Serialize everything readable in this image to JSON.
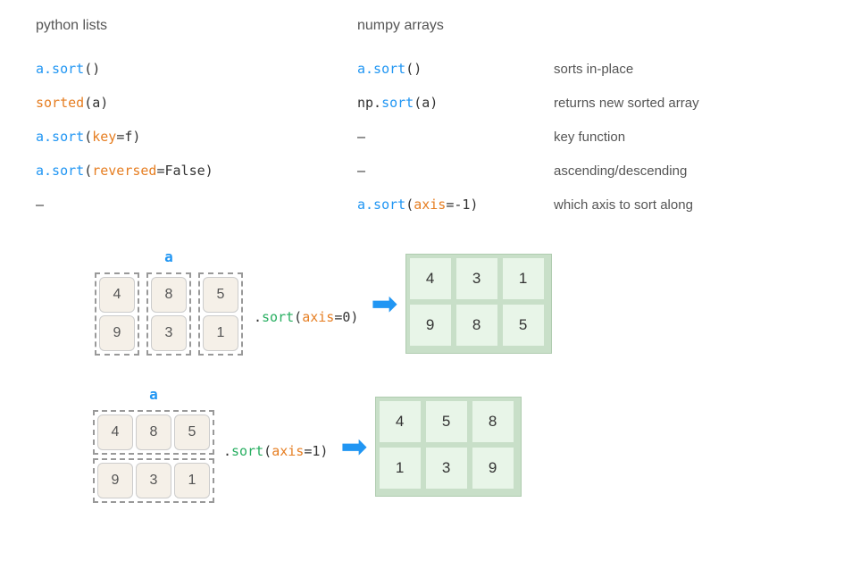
{
  "headers": {
    "python_lists": "python lists",
    "numpy_arrays": "numpy arrays"
  },
  "table": {
    "rows": [
      {
        "python": {
          "text": "a.sort()",
          "parts": [
            {
              "t": "blue",
              "v": "a.sort"
            },
            {
              "t": "dark",
              "v": "()"
            }
          ]
        },
        "numpy": {
          "text": "a.sort()",
          "parts": [
            {
              "t": "blue",
              "v": "a.sort"
            },
            {
              "t": "dark",
              "v": "()"
            }
          ]
        },
        "desc": "sorts in-place"
      },
      {
        "python": {
          "text": "sorted(a)",
          "parts": [
            {
              "t": "orange",
              "v": "sorted"
            },
            {
              "t": "dark",
              "v": "(a)"
            }
          ]
        },
        "numpy": {
          "text": "np.sort(a)",
          "parts": [
            {
              "t": "dark",
              "v": "np."
            },
            {
              "t": "blue",
              "v": "sort"
            },
            {
              "t": "dark",
              "v": "(a)"
            }
          ]
        },
        "desc": "returns new sorted array"
      },
      {
        "python": {
          "text": "a.sort(key=f)",
          "parts": [
            {
              "t": "blue",
              "v": "a.sort"
            },
            {
              "t": "dark",
              "v": "("
            },
            {
              "t": "orange",
              "v": "key"
            },
            {
              "t": "dark",
              "v": "=f)"
            }
          ]
        },
        "numpy": {
          "text": "–",
          "parts": [
            {
              "t": "dark",
              "v": "–"
            }
          ]
        },
        "desc": "key function"
      },
      {
        "python": {
          "text": "a.sort(reversed=False)",
          "parts": [
            {
              "t": "blue",
              "v": "a.sort"
            },
            {
              "t": "dark",
              "v": "("
            },
            {
              "t": "orange",
              "v": "reversed"
            },
            {
              "t": "dark",
              "v": "=False)"
            }
          ]
        },
        "numpy": {
          "text": "–",
          "parts": [
            {
              "t": "dark",
              "v": "–"
            }
          ]
        },
        "desc": "ascending/descending"
      },
      {
        "python": {
          "text": "–",
          "parts": [
            {
              "t": "dark",
              "v": "–"
            }
          ]
        },
        "numpy": {
          "text": "a.sort(axis=-1)",
          "parts": [
            {
              "t": "blue",
              "v": "a.sort"
            },
            {
              "t": "dark",
              "v": "("
            },
            {
              "t": "orange",
              "v": "axis"
            },
            {
              "t": "dark",
              "v": "=-1)"
            }
          ]
        },
        "desc": "which axis to sort along"
      }
    ]
  },
  "diagrams": {
    "axis0": {
      "label": "a",
      "input": [
        [
          4,
          8,
          5
        ],
        [
          9,
          3,
          1
        ]
      ],
      "sort_text_pre": ".",
      "sort_method": "sort",
      "sort_paren_open": "(",
      "sort_param_key": "axis",
      "sort_eq": "=",
      "sort_param_val": "0",
      "sort_paren_close": ")",
      "output": [
        [
          4,
          3,
          1
        ],
        [
          9,
          8,
          5
        ]
      ]
    },
    "axis1": {
      "label": "a",
      "input": [
        [
          4,
          8,
          5
        ],
        [
          9,
          3,
          1
        ]
      ],
      "sort_text_pre": ".",
      "sort_method": "sort",
      "sort_paren_open": "(",
      "sort_param_key": "axis",
      "sort_eq": "=",
      "sort_param_val": "1",
      "sort_paren_close": ")",
      "output": [
        [
          4,
          5,
          8
        ],
        [
          1,
          3,
          9
        ]
      ]
    }
  }
}
